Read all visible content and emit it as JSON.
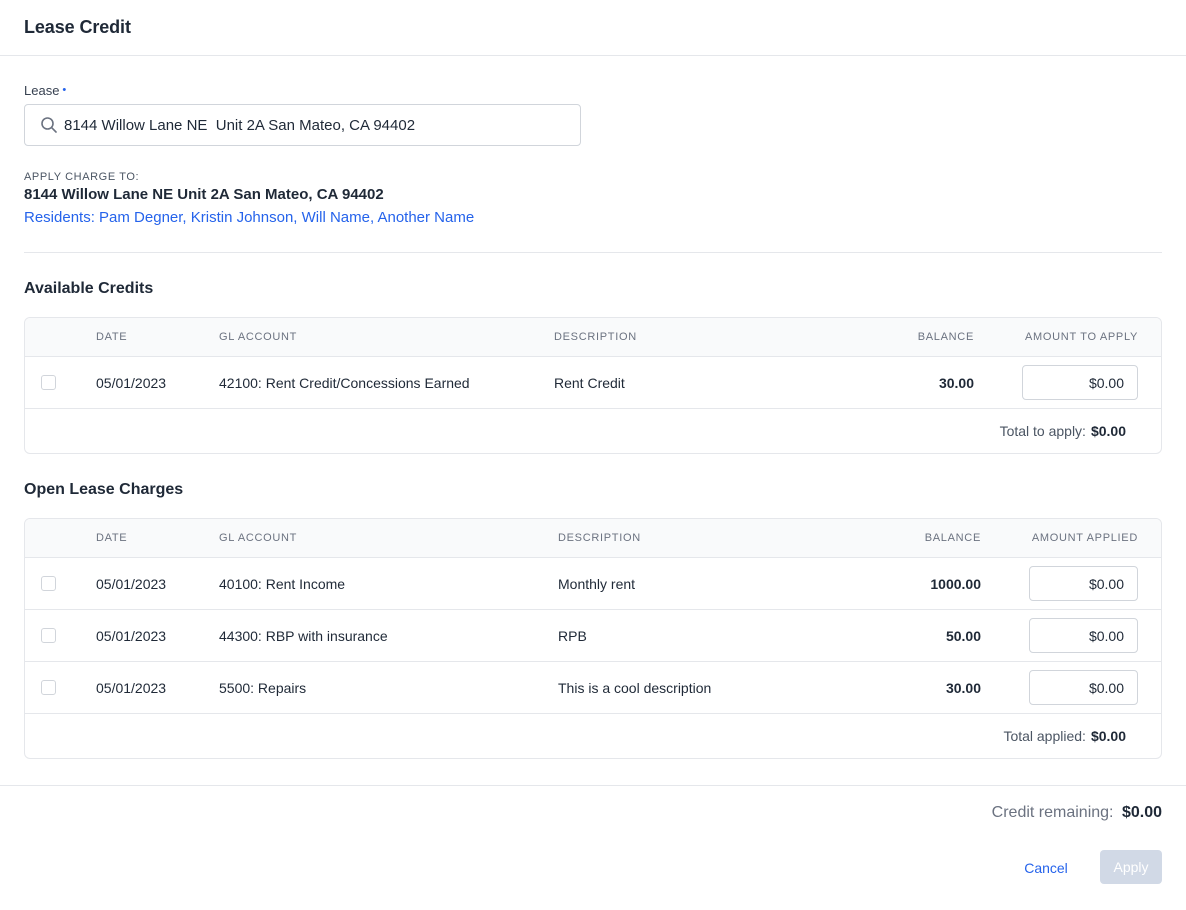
{
  "header": {
    "title": "Lease Credit"
  },
  "lease_field": {
    "label": "Lease",
    "required_marker": "•",
    "value": "8144 Willow Lane NE  Unit 2A San Mateo, CA 94402"
  },
  "apply_charge": {
    "label": "APPLY CHARGE TO:",
    "address": "8144 Willow Lane NE  Unit 2A San Mateo, CA 94402",
    "residents": "Residents: Pam Degner, Kristin Johnson, Will Name, Another Name"
  },
  "available_credits": {
    "title": "Available Credits",
    "columns": [
      "DATE",
      "GL ACCOUNT",
      "DESCRIPTION",
      "BALANCE",
      "AMOUNT TO APPLY"
    ],
    "rows": [
      {
        "date": "05/01/2023",
        "gl_account": "42100: Rent Credit/Concessions Earned",
        "description": "Rent Credit",
        "balance": "30.00",
        "amount": "$0.00"
      }
    ],
    "total_label": "Total to apply:",
    "total_value": "$0.00"
  },
  "open_charges": {
    "title": "Open Lease Charges",
    "columns": [
      "DATE",
      "GL ACCOUNT",
      "DESCRIPTION",
      "BALANCE",
      "AMOUNT APPLIED"
    ],
    "rows": [
      {
        "date": "05/01/2023",
        "gl_account": "40100: Rent Income",
        "description": "Monthly rent",
        "balance": "1000.00",
        "amount": "$0.00"
      },
      {
        "date": "05/01/2023",
        "gl_account": "44300: RBP with insurance",
        "description": "RPB",
        "balance": "50.00",
        "amount": "$0.00"
      },
      {
        "date": "05/01/2023",
        "gl_account": "5500: Repairs",
        "description": "This is a cool description",
        "balance": "30.00",
        "amount": "$0.00"
      }
    ],
    "total_label": "Total applied:",
    "total_value": "$0.00"
  },
  "footer": {
    "credit_remaining_label": "Credit remaining:",
    "credit_remaining_value": "$0.00",
    "cancel_label": "Cancel",
    "apply_label": "Apply"
  },
  "colors": {
    "accent": "#2563eb",
    "border": "#e5e7eb",
    "disabled_button": "#d1d9e6"
  },
  "icons": {
    "search": "search-icon"
  }
}
